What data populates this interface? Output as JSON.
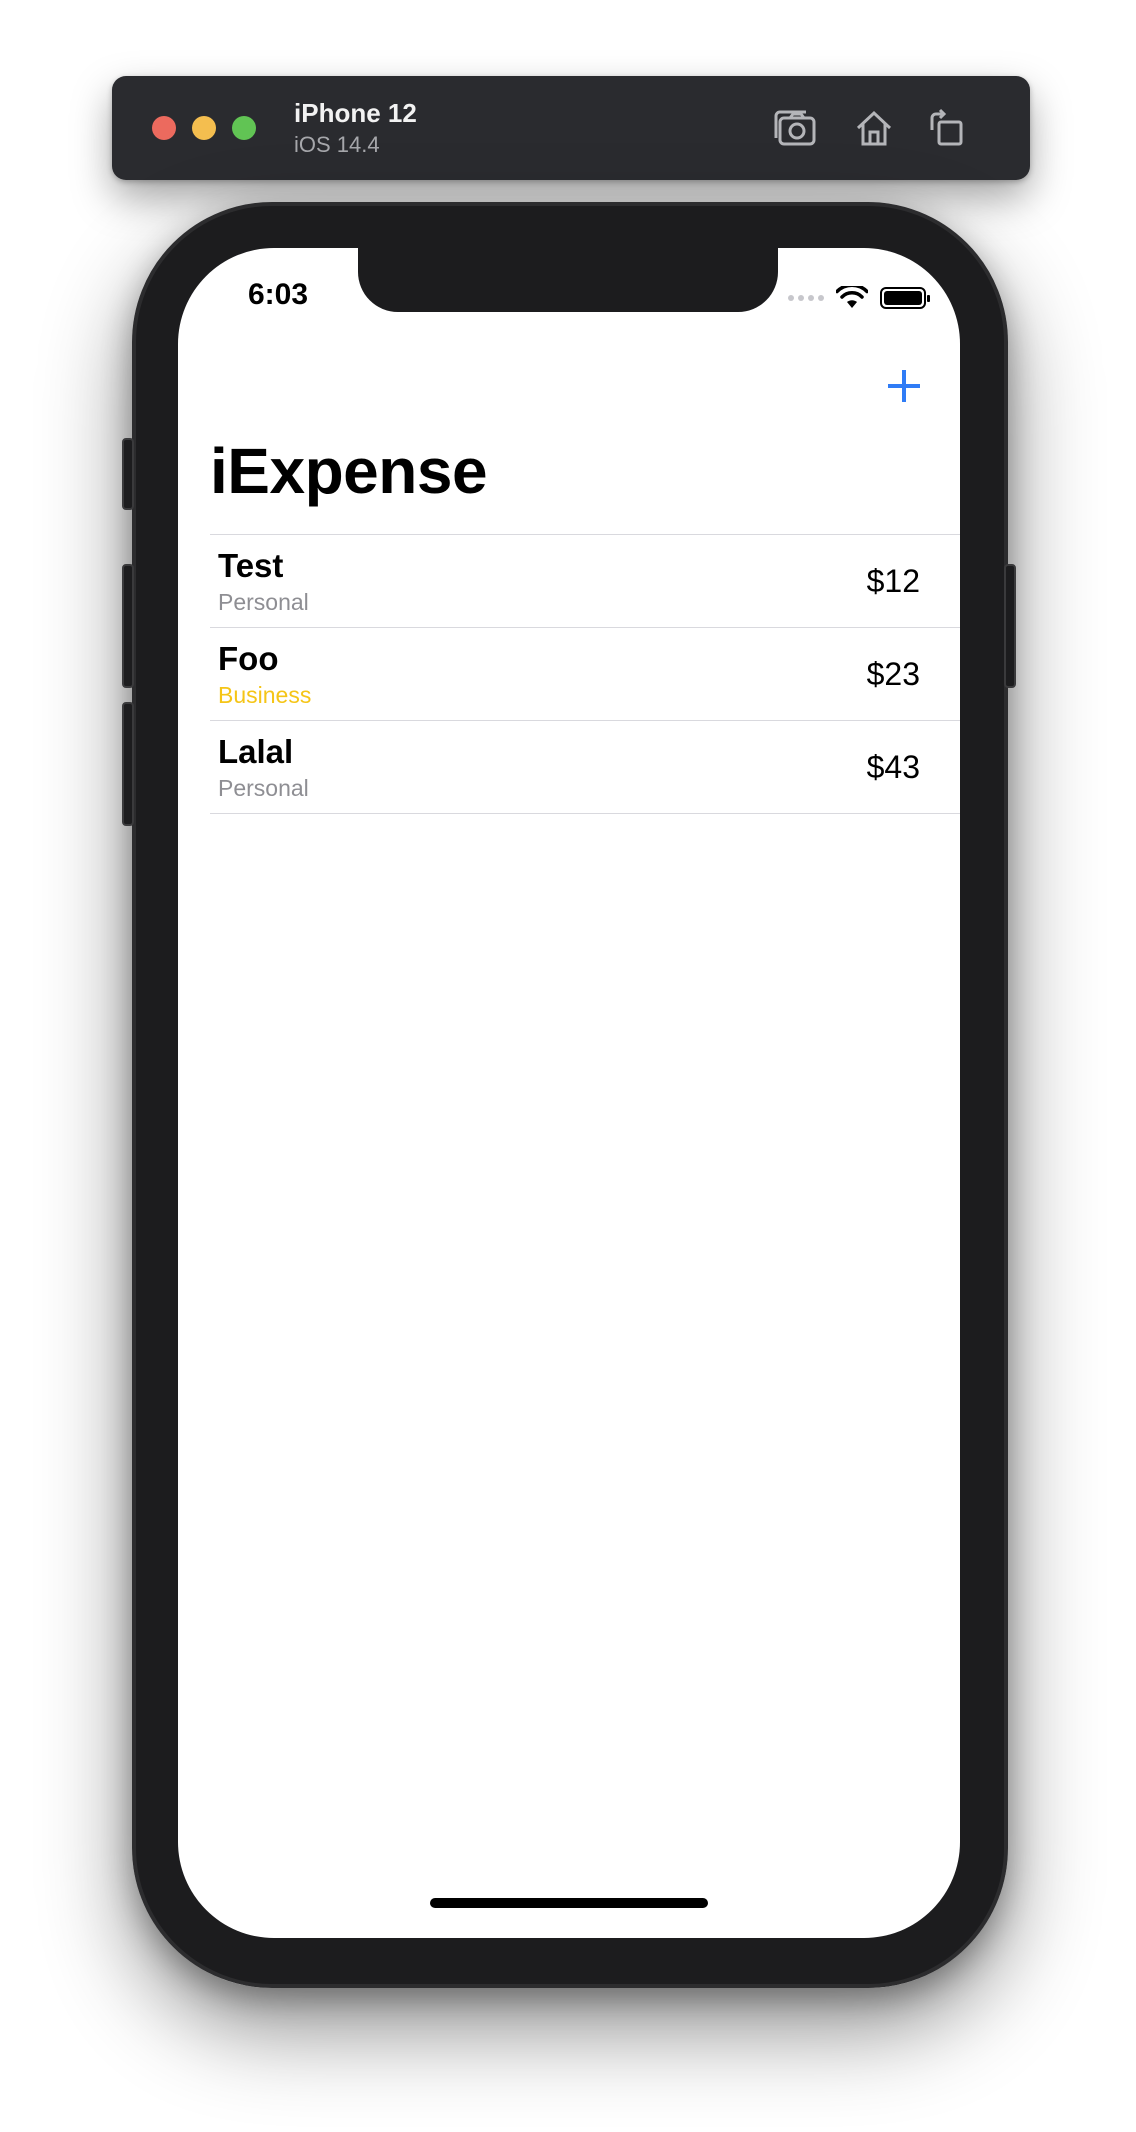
{
  "simulator": {
    "device_name": "iPhone 12",
    "os_version": "iOS 14.4",
    "icons": [
      "screenshot-icon",
      "home-icon",
      "rotate-icon"
    ]
  },
  "status_bar": {
    "time": "6:03",
    "icons": [
      "signal-icon",
      "wifi-icon",
      "battery-icon"
    ]
  },
  "nav": {
    "title": "iExpense",
    "add_icon": "plus-icon",
    "accent_color": "#2f7cf6"
  },
  "expenses": [
    {
      "name": "Test",
      "type": "Personal",
      "amount": "$12"
    },
    {
      "name": "Foo",
      "type": "Business",
      "amount": "$23"
    },
    {
      "name": "Lalal",
      "type": "Personal",
      "amount": "$43"
    }
  ],
  "colors": {
    "personal": "#8e8e93",
    "business": "#f5c517"
  }
}
